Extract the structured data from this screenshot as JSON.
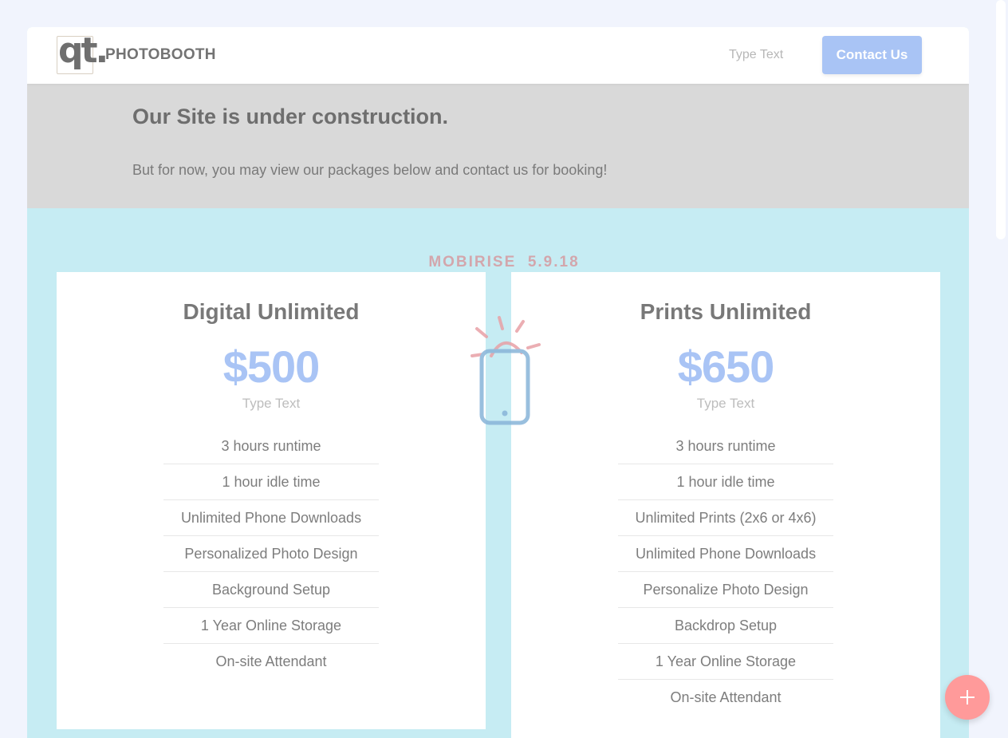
{
  "header": {
    "logo_text": "qt.",
    "brand": "PHOTOBOOTH",
    "nav_link": "Type Text",
    "contact_button": "Contact Us"
  },
  "notice": {
    "title": "Our Site is under construction.",
    "body": "But for now, you may view our packages below and contact us for booking!"
  },
  "watermark": "MOBIRISE  5.9.18",
  "packages": [
    {
      "title": "Digital Unlimited",
      "price": "$500",
      "subtitle": "Type Text",
      "features": [
        "3 hours runtime",
        "1 hour idle time",
        "Unlimited Phone Downloads",
        "Personalized Photo Design",
        "Background Setup",
        "1 Year Online Storage",
        "On-site Attendant"
      ]
    },
    {
      "title": "Prints Unlimited",
      "price": "$650",
      "subtitle": "Type Text",
      "features": [
        "3 hours runtime",
        "1 hour idle time",
        "Unlimited Prints (2x6 or 4x6)",
        "Unlimited Phone Downloads",
        "Personalize Photo Design",
        "Backdrop Setup",
        "1 Year Online Storage",
        "On-site Attendant"
      ]
    }
  ],
  "icons": {
    "phone": "mobile-phone-icon",
    "fab": "plus-icon"
  },
  "colors": {
    "accent": "#a9c4f5",
    "section_bg": "#c6ecf3",
    "notice_bg": "#d9d9d9",
    "fab": "#ff9a9a"
  }
}
